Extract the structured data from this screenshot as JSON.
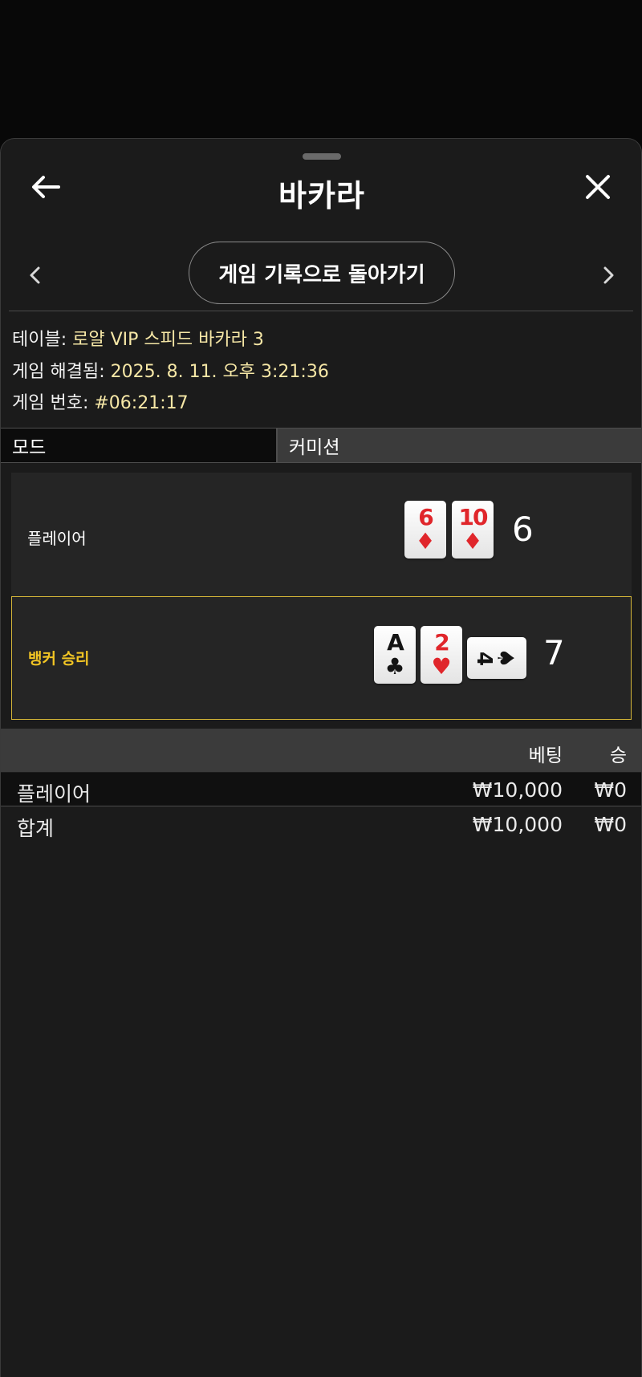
{
  "header": {
    "title": "바카라",
    "back_icon": "arrow-left-icon",
    "close_icon": "close-icon"
  },
  "nav": {
    "history_button": "게임 기록으로 돌아가기",
    "prev_icon": "chevron-left-icon",
    "next_icon": "chevron-right-icon"
  },
  "info": {
    "table_label": "테이블:",
    "table_value": "로얄 VIP 스피드 바카라 3",
    "resolved_label": "게임 해결됨:",
    "resolved_value": "2025. 8. 11. 오후 3:21:36",
    "number_label": "게임 번호:",
    "number_value": "#06:21:17"
  },
  "tabs": {
    "mode": "모드",
    "commission": "커미션"
  },
  "hands": {
    "player": {
      "label": "플레이어",
      "score": "6",
      "cards": [
        {
          "rank": "6",
          "suit": "♦",
          "color": "#e0262b"
        },
        {
          "rank": "10",
          "suit": "♦",
          "color": "#e0262b"
        }
      ]
    },
    "banker": {
      "label": "뱅커 승리",
      "score": "7",
      "cards": [
        {
          "rank": "A",
          "suit": "♣",
          "color": "#141414"
        },
        {
          "rank": "2",
          "suit": "♥",
          "color": "#e0262b"
        },
        {
          "rank": "4",
          "suit": "♠",
          "color": "#141414",
          "orientation": "sideways"
        }
      ]
    },
    "highlight_color": "#d4b538",
    "winner_text_color": "#f2c524"
  },
  "bets": {
    "headers": {
      "bet": "베팅",
      "win": "승"
    },
    "rows": [
      {
        "name": "플레이어",
        "bet": "₩10,000",
        "win": "₩0"
      }
    ],
    "total": {
      "name": "합계",
      "bet": "₩10,000",
      "win": "₩0"
    }
  }
}
